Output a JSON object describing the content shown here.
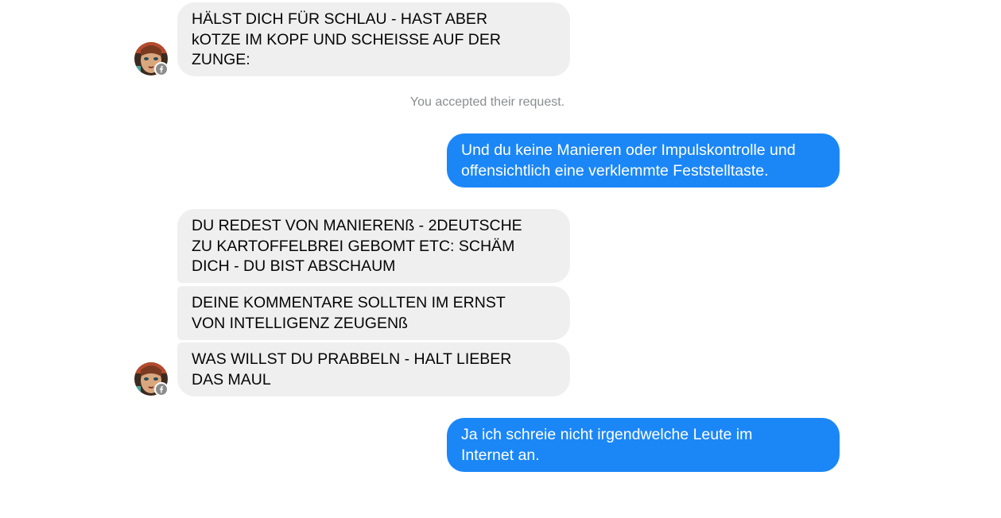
{
  "messages": {
    "m1": "HÄLST DICH FÜR SCHLAU - HAST ABER\nkOTZE IM KOPF UND SCHEISSE AUF DER\nZUNGE:",
    "status": "You accepted their request.",
    "m2": "Und du keine Manieren oder Impulskontrolle und\noffensichtlich eine verklemmte Feststelltaste.",
    "m3": "DU REDEST VON MANIERENß - 2DEUTSCHE\nZU KARTOFFELBREI GEBOMT ETC:    SCHÄM\nDICH - DU BIST ABSCHAUM",
    "m4": "DEINE KOMMENTARE SOLLTEN IM ERNST\nVON INTELLIGENZ ZEUGENß",
    "m5": "WAS WILLST DU PRABBELN - HALT LIEBER\nDAS MAUL",
    "m6": "Ja ich schreie nicht irgendwelche Leute im\nInternet an."
  },
  "icons": {
    "avatar": "contact-avatar",
    "badge": "facebook-badge-icon"
  },
  "colors": {
    "incoming_bubble": "#efefef",
    "outgoing_bubble": "#1b87f7",
    "status_text": "#8a8d91"
  }
}
